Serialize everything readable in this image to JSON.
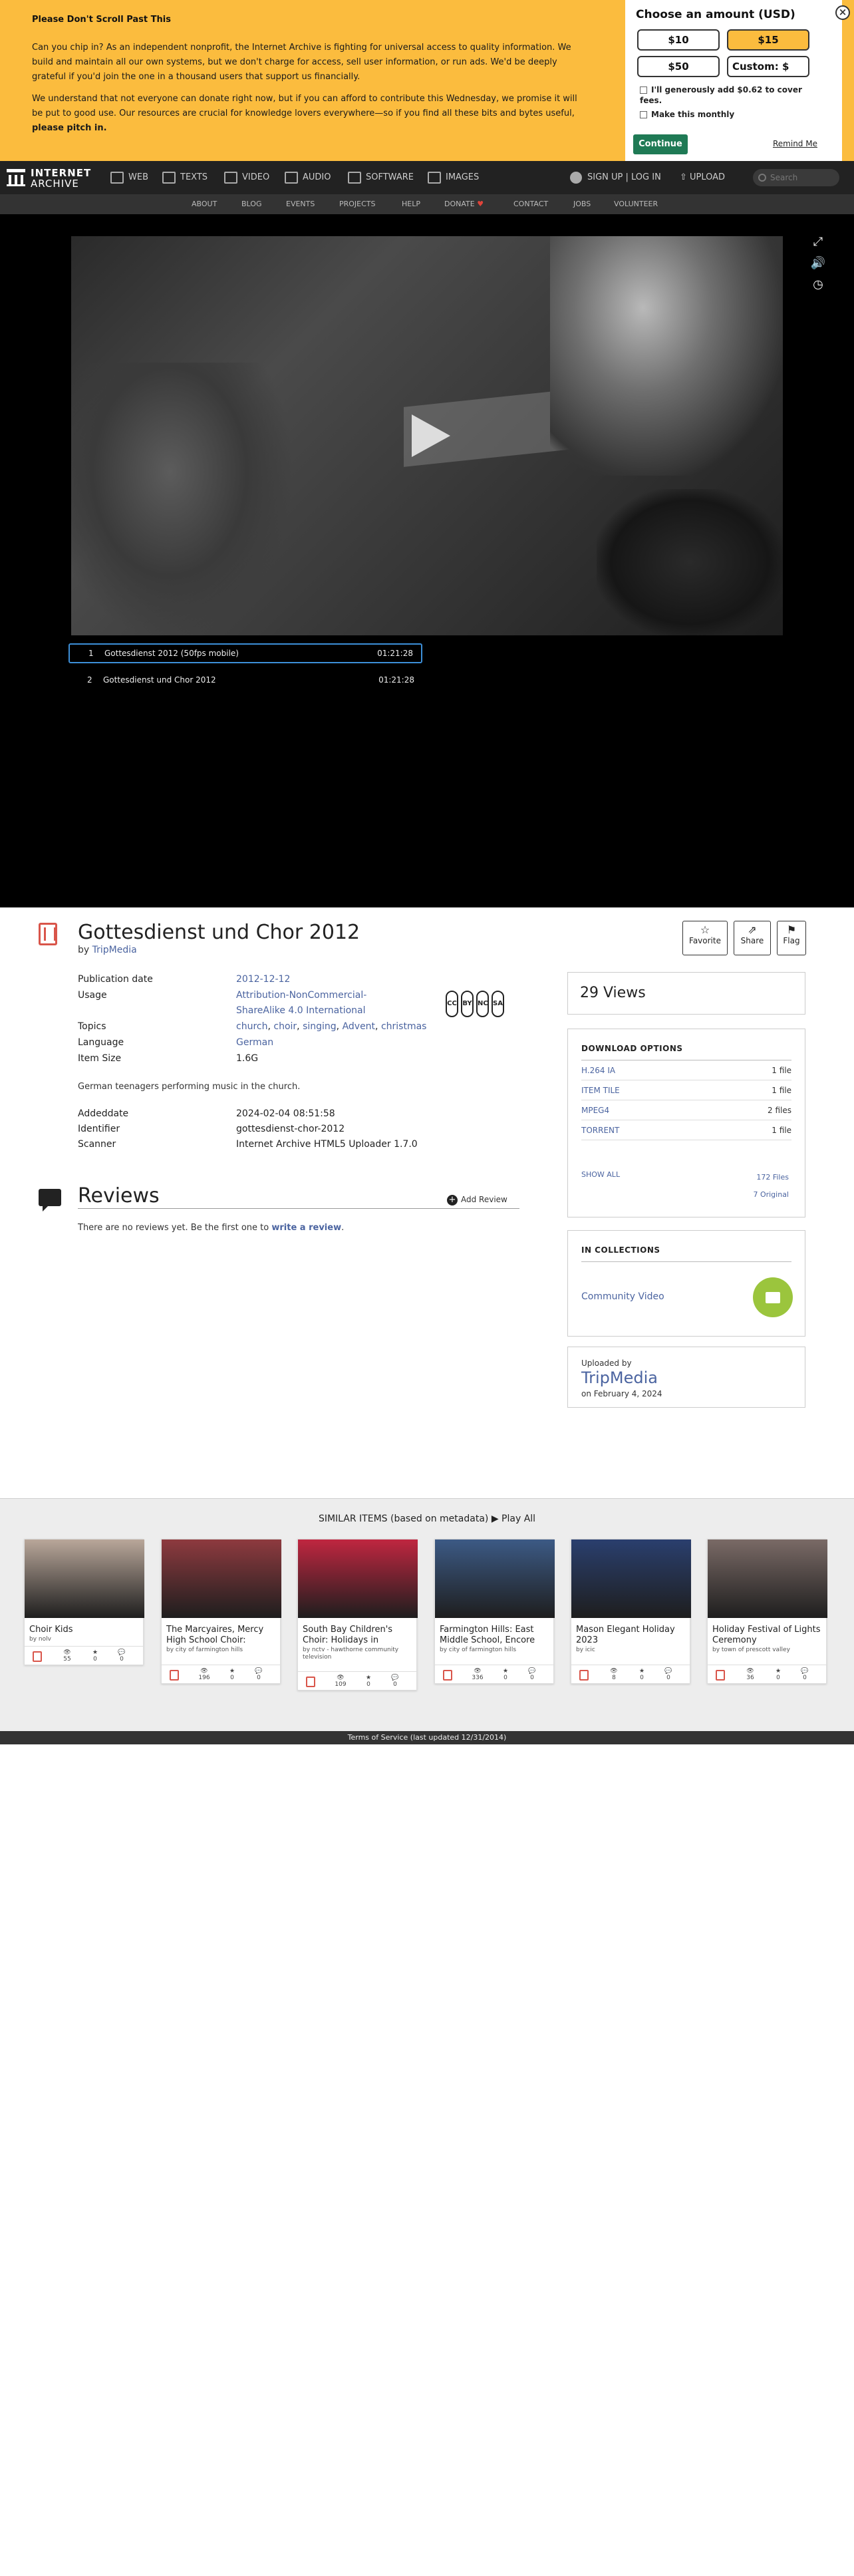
{
  "donate": {
    "title": "Please Don't Scroll Past This",
    "p1": "Can you chip in? As an independent nonprofit, the Internet Archive is fighting for universal access to quality information. We build and maintain all our own systems, but we don't charge for access, sell user information, or run ads. We'd be deeply grateful if you'd join the one in a thousand users that support us financially.",
    "p2a": "We understand that not everyone can donate right now, but if you can afford to contribute this Wednesday, we promise it will be put to good use. Our resources are crucial for knowledge lovers everywhere—so if you find all these bits and bytes useful, ",
    "p2b": "please pitch in.",
    "amount_head": "Choose an amount (USD)",
    "amounts": [
      "$10",
      "$15",
      "$50",
      "Custom: $"
    ],
    "cover_fees": "I'll generously add $0.62 to cover fees.",
    "monthly": "Make this monthly",
    "continue": "Continue",
    "remind": "Remind Me",
    "close": "×"
  },
  "nav": {
    "logo_line1": "INTERNET",
    "logo_line2": "ARCHIVE",
    "media": [
      "WEB",
      "TEXTS",
      "VIDEO",
      "AUDIO",
      "SOFTWARE",
      "IMAGES"
    ],
    "signup": "SIGN UP | LOG IN",
    "upload": "UPLOAD",
    "search_placeholder": "Search",
    "sub": [
      "ABOUT",
      "BLOG",
      "EVENTS",
      "PROJECTS",
      "HELP",
      "DONATE",
      "CONTACT",
      "JOBS",
      "VOLUNTEER"
    ]
  },
  "playlist": [
    {
      "n": "1",
      "title": "Gottesdienst 2012 (50fps mobile)",
      "dur": "01:21:28"
    },
    {
      "n": "2",
      "title": "Gottesdienst und Chor 2012",
      "dur": "01:21:28"
    }
  ],
  "item": {
    "title": "Gottesdienst und Chor 2012",
    "by": "by",
    "creator": "TripMedia",
    "actions": [
      "Favorite",
      "Share",
      "Flag"
    ],
    "meta": {
      "pubdate_k": "Publication date",
      "pubdate_v": "2012-12-12",
      "usage_k": "Usage",
      "usage_v1": "Attribution-NonCommercial-",
      "usage_v2": "ShareAlike 4.0 International",
      "topics_k": "Topics",
      "topics": [
        "church",
        "choir",
        "singing",
        "Advent",
        "christmas"
      ],
      "language_k": "Language",
      "language_v": "German",
      "size_k": "Item Size",
      "size_v": "1.6G",
      "added_k": "Addeddate",
      "added_v": "2024-02-04 08:51:58",
      "ident_k": "Identifier",
      "ident_v": "gottesdienst-chor-2012",
      "scanner_k": "Scanner",
      "scanner_v": "Internet Archive HTML5 Uploader 1.7.0"
    },
    "cc_icons": [
      "CC",
      "BY",
      "NC",
      "SA"
    ],
    "description": "German teenagers performing music in the church."
  },
  "reviews": {
    "title": "Reviews",
    "add": "Add Review",
    "none": "There are no reviews yet. Be the first one to ",
    "link": "write a review",
    "end": "."
  },
  "sidebar": {
    "views": "29 Views",
    "download_head": "DOWNLOAD OPTIONS",
    "downloads": [
      {
        "fmt": "H.264 IA",
        "count": "1 file"
      },
      {
        "fmt": "ITEM TILE",
        "count": "1 file"
      },
      {
        "fmt": "MPEG4",
        "count": "2 files"
      },
      {
        "fmt": "TORRENT",
        "count": "1 file"
      }
    ],
    "show_all": "SHOW ALL",
    "total_files": "172 Files",
    "original": "7 Original",
    "collections_head": "IN COLLECTIONS",
    "collection": "Community Video",
    "uploaded_by": "Uploaded by",
    "uploader": "TripMedia",
    "upload_date": "on February 4, 2024"
  },
  "similar": {
    "head": "SIMILAR ITEMS (based on metadata)",
    "play_all": "Play All",
    "cards": [
      {
        "title": "Choir Kids",
        "by": "by nolv",
        "views": "55",
        "favs": "0",
        "reviews": "0",
        "color": "#b9a79a"
      },
      {
        "title": "The Marcyaires, Mercy High School Choir:",
        "by": "by city of farmington hills",
        "views": "196",
        "favs": "0",
        "reviews": "0",
        "color": "#8e3a3f"
      },
      {
        "title": "South Bay Children's Choir: Holidays in",
        "by": "by nctv - hawthorne community television",
        "views": "109",
        "favs": "0",
        "reviews": "0",
        "color": "#c02640"
      },
      {
        "title": "Farmington Hills: East Middle School, Encore",
        "by": "by city of farmington hills",
        "views": "336",
        "favs": "0",
        "reviews": "0",
        "color": "#3c5a85"
      },
      {
        "title": "Mason Elegant Holiday 2023",
        "by": "by icic",
        "views": "8",
        "favs": "0",
        "reviews": "0",
        "color": "#2a3f6e"
      },
      {
        "title": "Holiday Festival of Lights Ceremony",
        "by": "by town of prescott valley",
        "views": "36",
        "favs": "0",
        "reviews": "0",
        "color": "#7a6a66"
      }
    ]
  },
  "footer": "Terms of Service (last updated 12/31/2014)"
}
